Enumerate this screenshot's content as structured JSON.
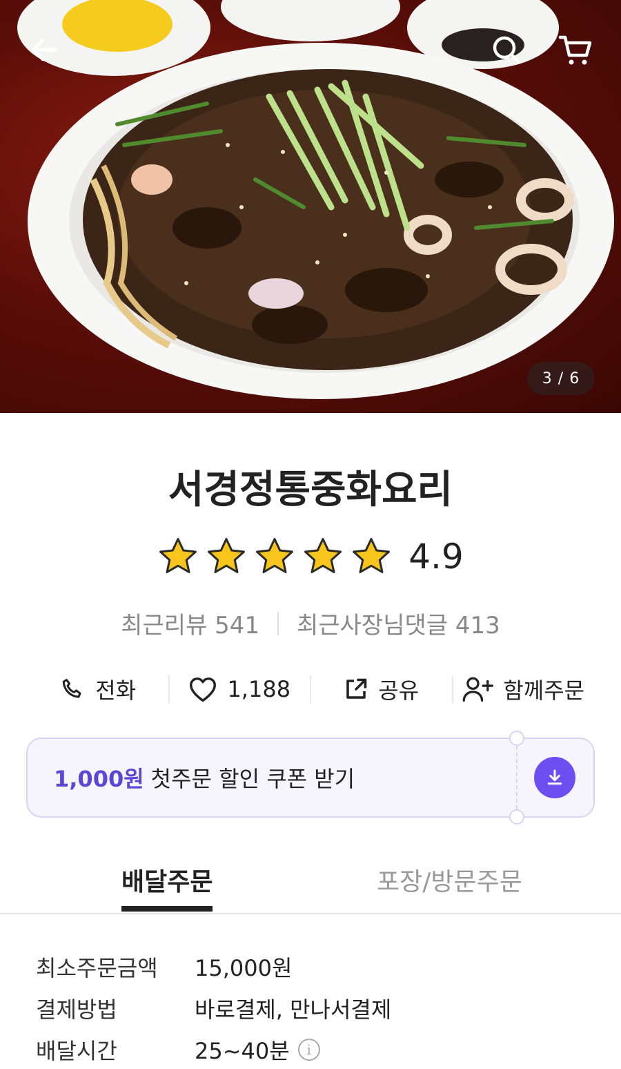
{
  "hero": {
    "image_description_icon": "jjajangmyeon-dish-photo",
    "counter": "3 / 6"
  },
  "nav": {
    "back_icon": "arrow-left-icon",
    "search_icon": "search-icon",
    "cart_icon": "cart-icon"
  },
  "store": {
    "name": "서경정통중화요리",
    "rating": "4.9",
    "stars": 5,
    "recent_reviews": "최근리뷰 541",
    "owner_replies": "최근사장님댓글 413"
  },
  "actions": [
    {
      "icon": "phone-icon",
      "label": "전화"
    },
    {
      "icon": "heart-icon",
      "label": "1,188"
    },
    {
      "icon": "share-icon",
      "label": "공유"
    },
    {
      "icon": "add-user-icon",
      "label": "함께주문"
    }
  ],
  "coupon": {
    "amount": "1,000원",
    "text": "첫주문 할인 쿠폰 받기",
    "accent": "#6c4ff0"
  },
  "tabs": {
    "delivery": "배달주문",
    "pickup": "포장/방문주문"
  },
  "info": [
    {
      "label": "최소주문금액",
      "value": "15,000원"
    },
    {
      "label": "결제방법",
      "value": "바로결제, 만나서결제"
    },
    {
      "label": "배달시간",
      "value": "25~40분"
    }
  ]
}
